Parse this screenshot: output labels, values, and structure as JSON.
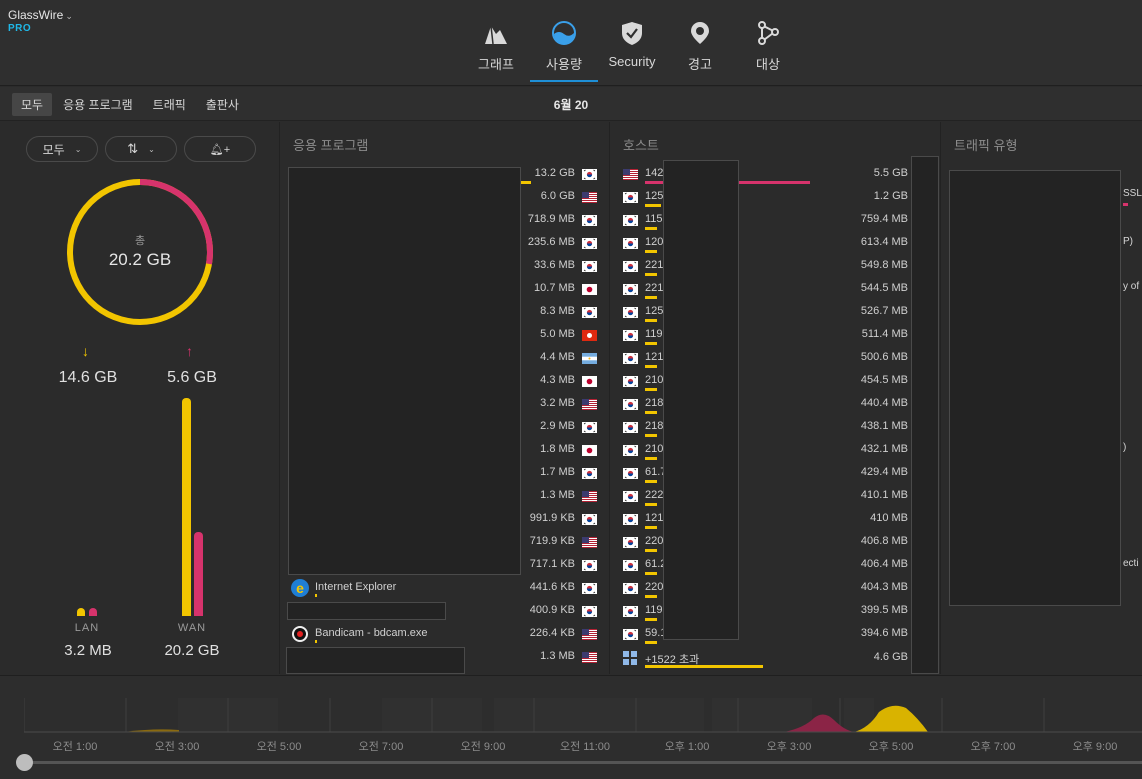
{
  "brand": {
    "name": "GlassWire",
    "tier": "PRO"
  },
  "nav": [
    {
      "label": "그래프",
      "icon": "graph-icon",
      "active": false
    },
    {
      "label": "사용량",
      "icon": "usage-icon",
      "active": true
    },
    {
      "label": "Security",
      "icon": "security-shield-icon",
      "active": false
    },
    {
      "label": "경고",
      "icon": "alert-pin-icon",
      "active": false
    },
    {
      "label": "대상",
      "icon": "things-nodes-icon",
      "active": false
    }
  ],
  "filters": [
    {
      "label": "모두",
      "active": true
    },
    {
      "label": "응용 프로그램",
      "active": false
    },
    {
      "label": "트래픽",
      "active": false
    },
    {
      "label": "출판사",
      "active": false
    }
  ],
  "date": "6월 20",
  "left": {
    "pill_all": "모두",
    "pill_sort_icon": "up-down-arrows-icon",
    "pill_bell_icon": "bell-plus-icon",
    "total_label": "총",
    "total_value": "20.2 GB",
    "download_value": "14.6 GB",
    "upload_value": "5.6 GB",
    "lan_label": "LAN",
    "lan_value": "3.2 MB",
    "wan_label": "WAN",
    "wan_value": "20.2 GB",
    "download_fraction": 0.723,
    "upload_fraction": 0.277,
    "colors": {
      "download": "#f2c500",
      "upload": "#d6336c"
    }
  },
  "apps": {
    "title": "응용 프로그램",
    "named": [
      {
        "name": "Internet Explorer",
        "icon": "internet-explorer-icon"
      },
      {
        "name": "Bandicam - bdcam.exe",
        "icon": "bandicam-icon"
      }
    ],
    "rows": [
      {
        "size": "13.2 GB",
        "flag": "kr"
      },
      {
        "size": "6.0 GB",
        "flag": "us"
      },
      {
        "size": "718.9 MB",
        "flag": "kr"
      },
      {
        "size": "235.6 MB",
        "flag": "kr"
      },
      {
        "size": "33.6 MB",
        "flag": "kr"
      },
      {
        "size": "10.7 MB",
        "flag": "jp"
      },
      {
        "size": "8.3 MB",
        "flag": "kr"
      },
      {
        "size": "5.0 MB",
        "flag": "hk"
      },
      {
        "size": "4.4 MB",
        "flag": "ar"
      },
      {
        "size": "4.3 MB",
        "flag": "jp"
      },
      {
        "size": "3.2 MB",
        "flag": "us"
      },
      {
        "size": "2.9 MB",
        "flag": "kr"
      },
      {
        "size": "1.8 MB",
        "flag": "jp"
      },
      {
        "size": "1.7 MB",
        "flag": "kr"
      },
      {
        "size": "1.3 MB",
        "flag": "us"
      },
      {
        "size": "991.9 KB",
        "flag": "kr"
      },
      {
        "size": "719.9 KB",
        "flag": "us"
      },
      {
        "size": "717.1 KB",
        "flag": "kr"
      },
      {
        "size": "441.6 KB",
        "flag": "kr"
      },
      {
        "size": "400.9 KB",
        "flag": "kr"
      },
      {
        "size": "226.4 KB",
        "flag": "us"
      },
      {
        "size": "1.3 MB",
        "flag": "us"
      }
    ]
  },
  "hosts": {
    "title": "호스트",
    "rows": [
      {
        "ip": "142",
        "size": "5.5 GB",
        "flag": "us"
      },
      {
        "ip": "125",
        "size": "1.2 GB",
        "flag": "kr"
      },
      {
        "ip": "115",
        "size": "759.4 MB",
        "flag": "kr"
      },
      {
        "ip": "120",
        "size": "613.4 MB",
        "flag": "kr"
      },
      {
        "ip": "221",
        "size": "549.8 MB",
        "flag": "kr"
      },
      {
        "ip": "221",
        "size": "544.5 MB",
        "flag": "kr"
      },
      {
        "ip": "125",
        "size": "526.7 MB",
        "flag": "kr"
      },
      {
        "ip": "119",
        "size": "511.4 MB",
        "flag": "kr"
      },
      {
        "ip": "121",
        "size": "500.6 MB",
        "flag": "kr"
      },
      {
        "ip": "210",
        "size": "454.5 MB",
        "flag": "kr"
      },
      {
        "ip": "218",
        "size": "440.4 MB",
        "flag": "kr"
      },
      {
        "ip": "218",
        "size": "438.1 MB",
        "flag": "kr"
      },
      {
        "ip": "210",
        "size": "432.1 MB",
        "flag": "kr"
      },
      {
        "ip": "61.7",
        "size": "429.4 MB",
        "flag": "kr"
      },
      {
        "ip": "222",
        "size": "410.1 MB",
        "flag": "kr"
      },
      {
        "ip": "121",
        "size": "410 MB",
        "flag": "kr"
      },
      {
        "ip": "220",
        "size": "406.8 MB",
        "flag": "kr"
      },
      {
        "ip": "61.2",
        "size": "406.4 MB",
        "flag": "kr"
      },
      {
        "ip": "220",
        "size": "404.3 MB",
        "flag": "kr"
      },
      {
        "ip": "119",
        "size": "399.5 MB",
        "flag": "kr"
      },
      {
        "ip": "59.1",
        "size": "394.6 MB",
        "flag": "kr"
      }
    ],
    "more_label": "+1522 초과",
    "more_size": "4.6 GB"
  },
  "traffic": {
    "title": "트래픽 유형",
    "fragments": [
      "SSL/",
      "P)",
      "y of",
      ")",
      "ecti"
    ]
  },
  "timeline": {
    "ticks": [
      "오전 1:00",
      "오전 3:00",
      "오전 5:00",
      "오전 7:00",
      "오전 9:00",
      "오전 11:00",
      "오후 1:00",
      "오후 3:00",
      "오후 5:00",
      "오후 7:00",
      "오후 9:00"
    ]
  }
}
